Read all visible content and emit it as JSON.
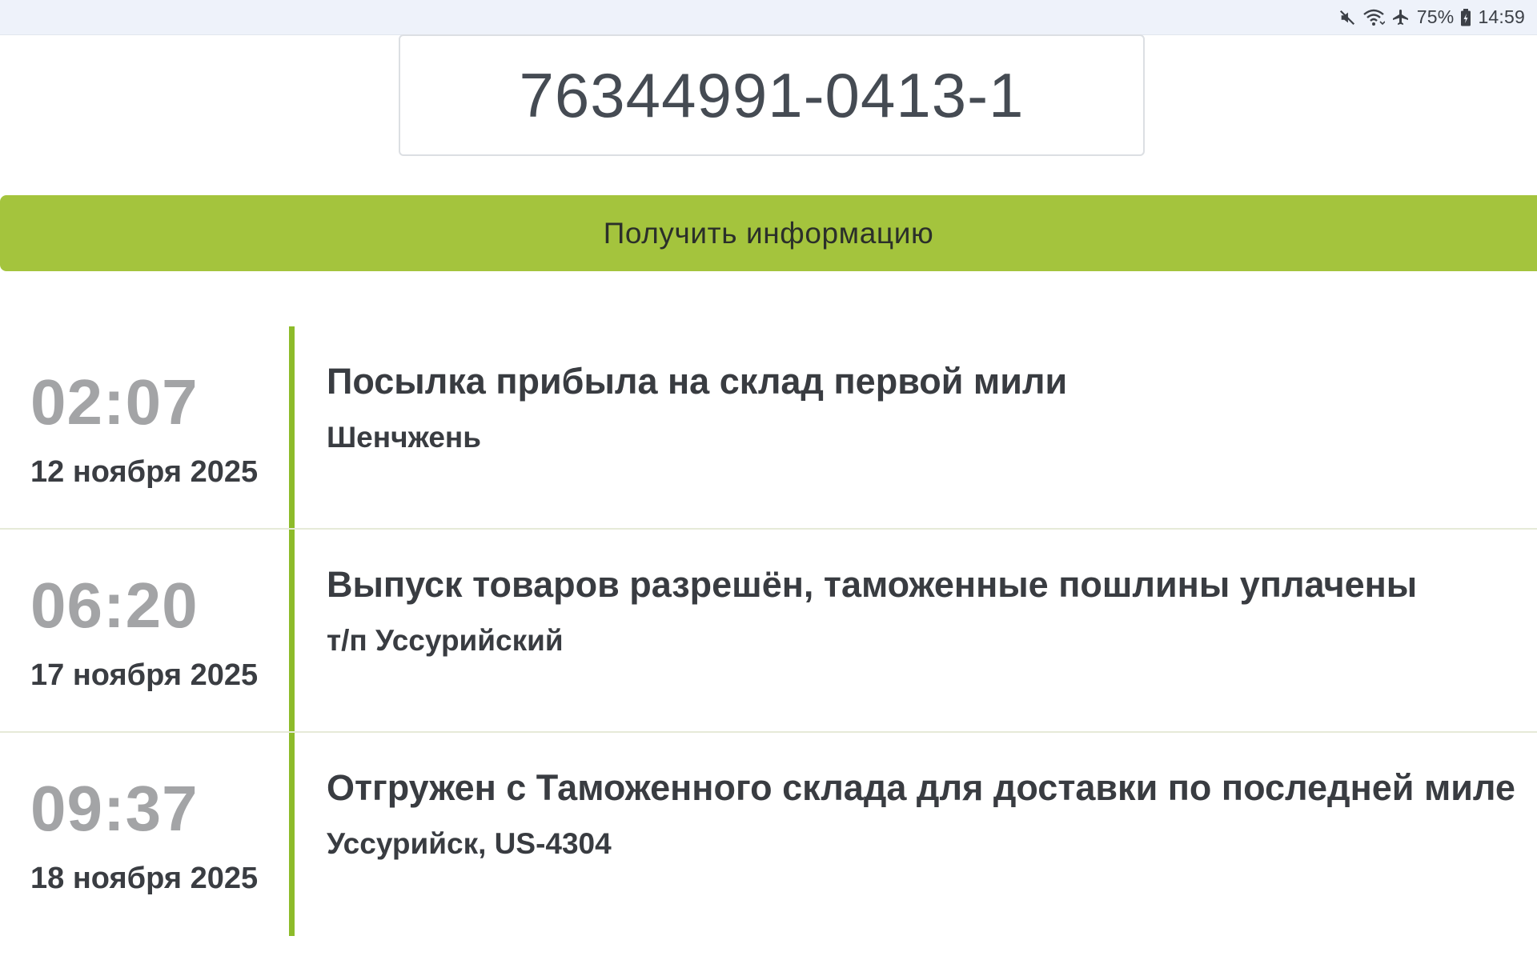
{
  "status_bar": {
    "icons": [
      "mute-icon",
      "wifi-icon",
      "airplane-icon",
      "battery-icon"
    ],
    "battery_text": "75%",
    "time": "14:59"
  },
  "tracking": {
    "value": "76344991-0413-1"
  },
  "submit": {
    "label": "Получить информацию",
    "color": "#a4c43d"
  },
  "timeline": {
    "line_color": "#8dbb2a",
    "events": [
      {
        "time": "02:07",
        "date": "12 ноября 2025",
        "title": "Посылка прибыла на склад первой мили",
        "place": "Шенчжень"
      },
      {
        "time": "06:20",
        "date": "17 ноября 2025",
        "title": "Выпуск товаров разрешён, таможенные пошлины уплачены",
        "place": "т/п Уссурийский"
      },
      {
        "time": "09:37",
        "date": "18 ноября 2025",
        "title": "Отгружен с Таможенного склада для доставки по последней миле",
        "place": "Уссурийск, US-4304"
      }
    ]
  }
}
